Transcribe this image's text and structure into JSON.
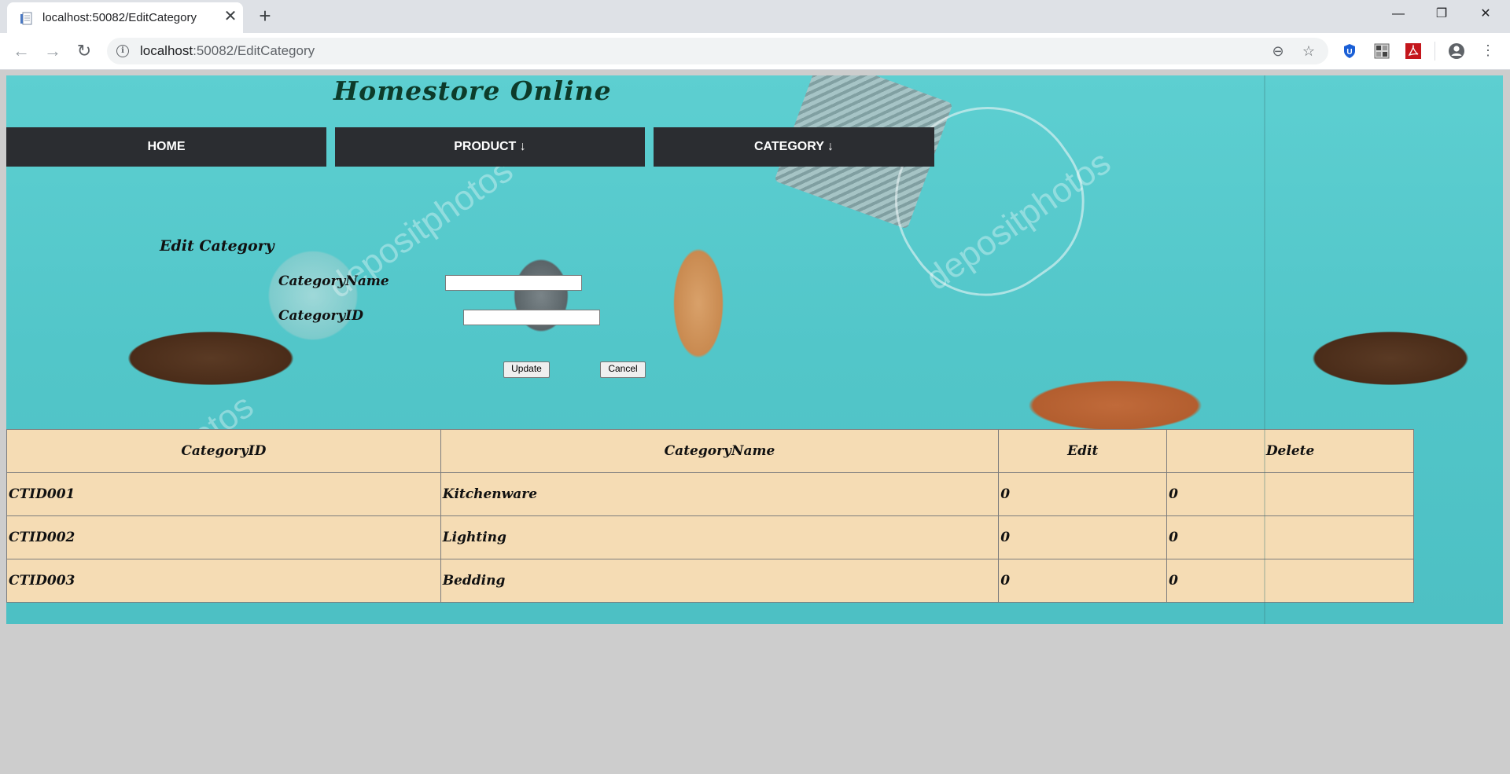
{
  "browser": {
    "tab_title": "localhost:50082/EditCategory",
    "url_host": "localhost",
    "url_rest": ":50082/EditCategory",
    "new_tab_icon": "plus-icon",
    "window_controls": [
      "minimize",
      "restore",
      "close"
    ]
  },
  "site": {
    "title": "Homestore Online"
  },
  "nav": {
    "home": "HOME",
    "product": "PRODUCT ↓",
    "category": "CATEGORY ↓"
  },
  "form": {
    "heading": "Edit Category",
    "name_label": "CategoryName",
    "id_label": "CategoryID",
    "name_value": "",
    "id_value": "",
    "update_label": "Update",
    "cancel_label": "Cancel"
  },
  "table": {
    "headers": [
      "CategoryID",
      "CategoryName",
      "Edit",
      "Delete"
    ],
    "rows": [
      [
        "CTID001",
        "Kitchenware",
        "0",
        "0"
      ],
      [
        "CTID002",
        "Lighting",
        "0",
        "0"
      ],
      [
        "CTID003",
        "Bedding",
        "0",
        "0"
      ]
    ]
  },
  "colors": {
    "nav_bg": "#2b2d31",
    "table_bg": "#f5dcb4",
    "title_color": "#0d3b2a",
    "page_bg": "#cdcdcd"
  }
}
